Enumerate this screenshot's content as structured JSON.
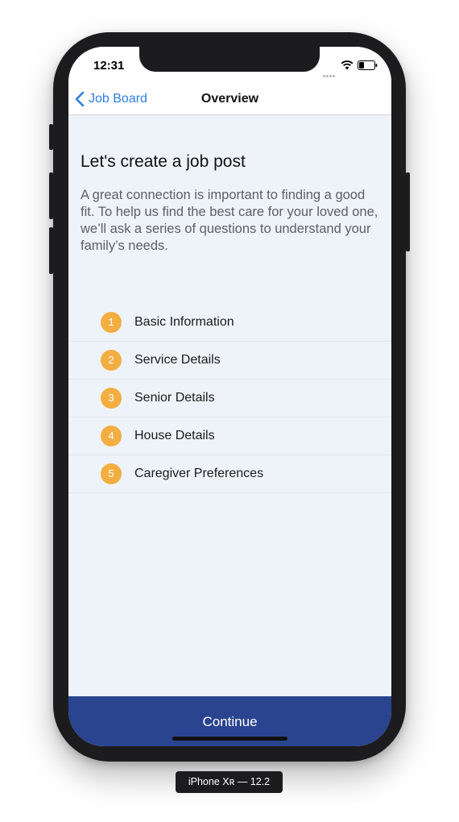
{
  "status_bar": {
    "time": "12:31",
    "icons": [
      "signal-dots-icon",
      "wifi-icon",
      "battery-icon"
    ]
  },
  "nav": {
    "back_label": "Job Board",
    "title": "Overview"
  },
  "main": {
    "heading": "Let's create a job post",
    "intro": "A great connection is important to finding a good fit. To help us find the best care for your loved one, we’ll ask a series of questions to understand your family’s needs.",
    "steps": [
      {
        "number": "1",
        "label": "Basic Information"
      },
      {
        "number": "2",
        "label": "Service Details"
      },
      {
        "number": "3",
        "label": "Senior Details"
      },
      {
        "number": "4",
        "label": "House Details"
      },
      {
        "number": "5",
        "label": "Caregiver Preferences"
      }
    ]
  },
  "footer": {
    "continue_label": "Continue"
  },
  "simulator": {
    "device_label": "iPhone Xʀ — 12.2"
  },
  "colors": {
    "accent_blue": "#2f7ee6",
    "step_badge": "#f3ae42",
    "continue_bg": "#2b4490",
    "content_bg": "#eef3f9"
  }
}
